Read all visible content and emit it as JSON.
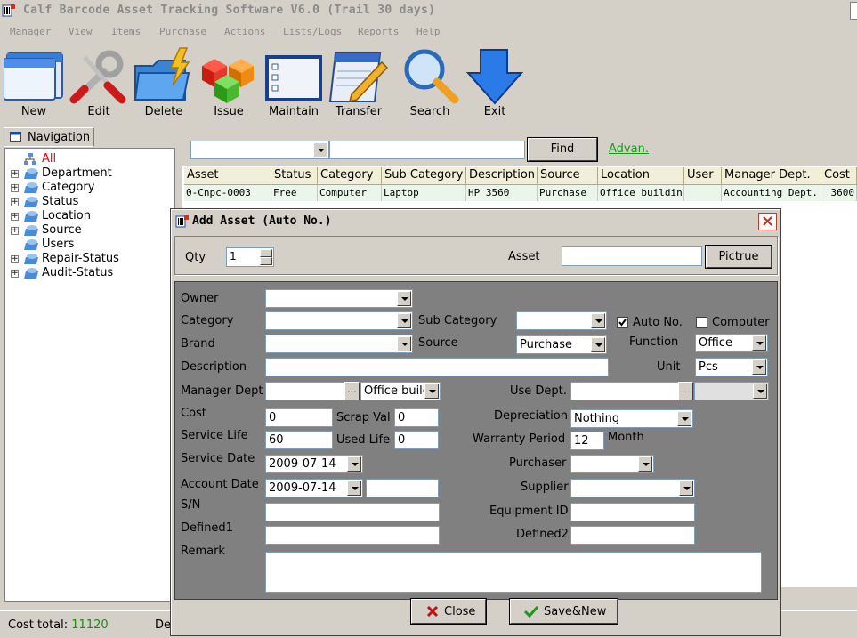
{
  "window": {
    "title": "Calf Barcode Asset Tracking Software V6.0 (Trail 30 days)"
  },
  "menu": [
    "Manager",
    "View",
    "Items",
    "Purchase",
    "Actions",
    "Lists/Logs",
    "Reports",
    "Help"
  ],
  "toolbar": [
    {
      "label": "New",
      "icon": "new-window-icon"
    },
    {
      "label": "Edit",
      "icon": "tools-icon"
    },
    {
      "label": "Delete",
      "icon": "folder-lightning-icon"
    },
    {
      "label": "Issue",
      "icon": "cubes-icon"
    },
    {
      "label": "Maintain",
      "icon": "list-window-icon"
    },
    {
      "label": "Transfer",
      "icon": "notepad-pen-icon"
    },
    {
      "label": "Search",
      "icon": "magnifier-icon"
    },
    {
      "label": "Exit",
      "icon": "down-arrow-icon"
    }
  ],
  "navigation": {
    "tab_label": "Navigation",
    "items": [
      "All",
      "Department",
      "Category",
      "Status",
      "Location",
      "Source",
      "Users",
      "Repair-Status",
      "Audit-Status"
    ]
  },
  "search": {
    "find_label": "Find",
    "advanced_label": "Advan."
  },
  "grid": {
    "headers": [
      "Asset",
      "Status",
      "Category",
      "Sub Category",
      "Description",
      "Source",
      "Location",
      "User",
      "Manager Dept.",
      "Cost"
    ],
    "rows": [
      [
        "0-Cnpc-0003",
        "Free",
        "Computer",
        "Laptop",
        "HP 3560",
        "Purchase",
        "Office building",
        "",
        "Accounting Dept.",
        "3600"
      ]
    ]
  },
  "status": {
    "cost_label": "Cost total:",
    "cost_value": "11120",
    "dept_label": "De"
  },
  "dialog": {
    "title": "Add Asset (Auto No.)",
    "qty_label": "Qty",
    "qty_value": "1",
    "asset_label": "Asset",
    "asset_value": "",
    "picture_button": "Pictrue",
    "labels": {
      "owner": "Owner",
      "category": "Category",
      "sub_category": "Sub Category",
      "auto_no": "Auto No.",
      "computer": "Computer",
      "brand": "Brand",
      "source": "Source",
      "function": "Function",
      "description": "Description",
      "unit": "Unit",
      "manager_dept": "Manager Dept",
      "use_dept": "Use Dept.",
      "cost": "Cost",
      "scrap_val": "Scrap Val",
      "depreciation": "Depreciation",
      "service_life": "Service Life",
      "used_life": "Used Life",
      "warranty": "Warranty Period",
      "month": "Month",
      "service_date": "Service Date",
      "purchaser": "Purchaser",
      "account_date": "Account Date",
      "supplier": "Supplier",
      "sn": "S/N",
      "equipment_id": "Equipment ID",
      "defined1": "Defined1",
      "defined2": "Defined2",
      "remark": "Remark"
    },
    "values": {
      "owner": "",
      "category": "",
      "sub_category": "",
      "brand": "",
      "source": "Purchase",
      "function": "Office",
      "description": "",
      "unit": "Pcs",
      "manager_dept": "",
      "manager_dept_select": "Office build",
      "use_dept": "",
      "use_dept_select": "",
      "cost": "0",
      "scrap_val": "0",
      "depreciation": "Nothing",
      "service_life": "60",
      "used_life": "0",
      "warranty": "12",
      "service_date": "2009-07-14",
      "purchaser": "",
      "account_date": "2009-07-14",
      "account_extra": "",
      "supplier": "",
      "sn": "",
      "equipment_id": "",
      "defined1": "",
      "defined2": "",
      "remark": ""
    },
    "checks": {
      "auto_no": true,
      "computer": false
    },
    "buttons": {
      "close": "Close",
      "save_new": "Save&New"
    }
  }
}
